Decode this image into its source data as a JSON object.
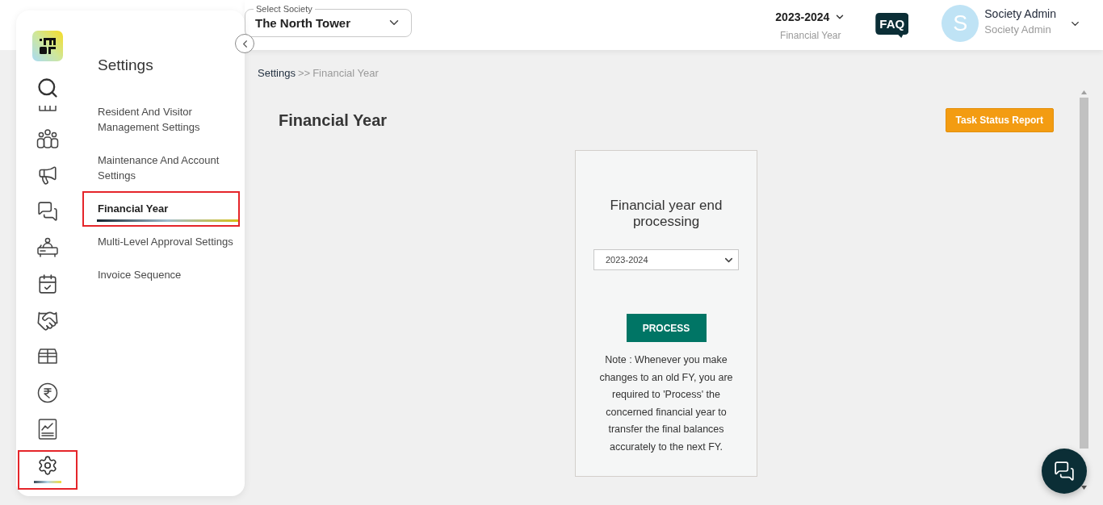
{
  "sidebar": {
    "nav_items": [
      {
        "selected": false,
        "highlighted": false
      },
      {
        "selected": false,
        "highlighted": false
      },
      {
        "selected": false,
        "highlighted": false
      },
      {
        "selected": false,
        "highlighted": false
      },
      {
        "selected": false,
        "highlighted": false
      },
      {
        "selected": false,
        "highlighted": false
      },
      {
        "selected": false,
        "highlighted": false
      },
      {
        "selected": false,
        "highlighted": false
      },
      {
        "selected": false,
        "highlighted": false
      },
      {
        "selected": true,
        "highlighted": true
      }
    ]
  },
  "settings_menu": {
    "title": "Settings",
    "items": [
      {
        "label": "Resident And Visitor Management Settings",
        "selected": false,
        "highlighted": false
      },
      {
        "label": "Maintenance And Account Settings",
        "selected": false,
        "highlighted": false
      },
      {
        "label": "Financial Year",
        "selected": true,
        "highlighted": true
      },
      {
        "label": "Multi-Level Approval Settings",
        "selected": false,
        "highlighted": false
      },
      {
        "label": "Invoice Sequence",
        "selected": false,
        "highlighted": false
      }
    ]
  },
  "header": {
    "society_select": {
      "label": "Select Society",
      "value": "The North Tower"
    },
    "financial_year": {
      "value": "2023-2024",
      "caption": "Financial Year"
    },
    "faq_label": "FAQ",
    "user": {
      "initial": "S",
      "name": "Society Admin",
      "role": "Society Admin"
    }
  },
  "breadcrumb": {
    "items": [
      "Settings",
      "Financial Year"
    ],
    "separator": ">>"
  },
  "page_title": "Financial Year",
  "task_status_button": "Task Status Report",
  "fy_card": {
    "title": "Financial year end processing",
    "year_select": {
      "value": "2023-2024"
    },
    "process_button": "PROCESS",
    "note": "Note : Whenever you make changes to an old FY, you are required to 'Process' the concerned financial year to transfer the final balances accurately to the next FY."
  }
}
